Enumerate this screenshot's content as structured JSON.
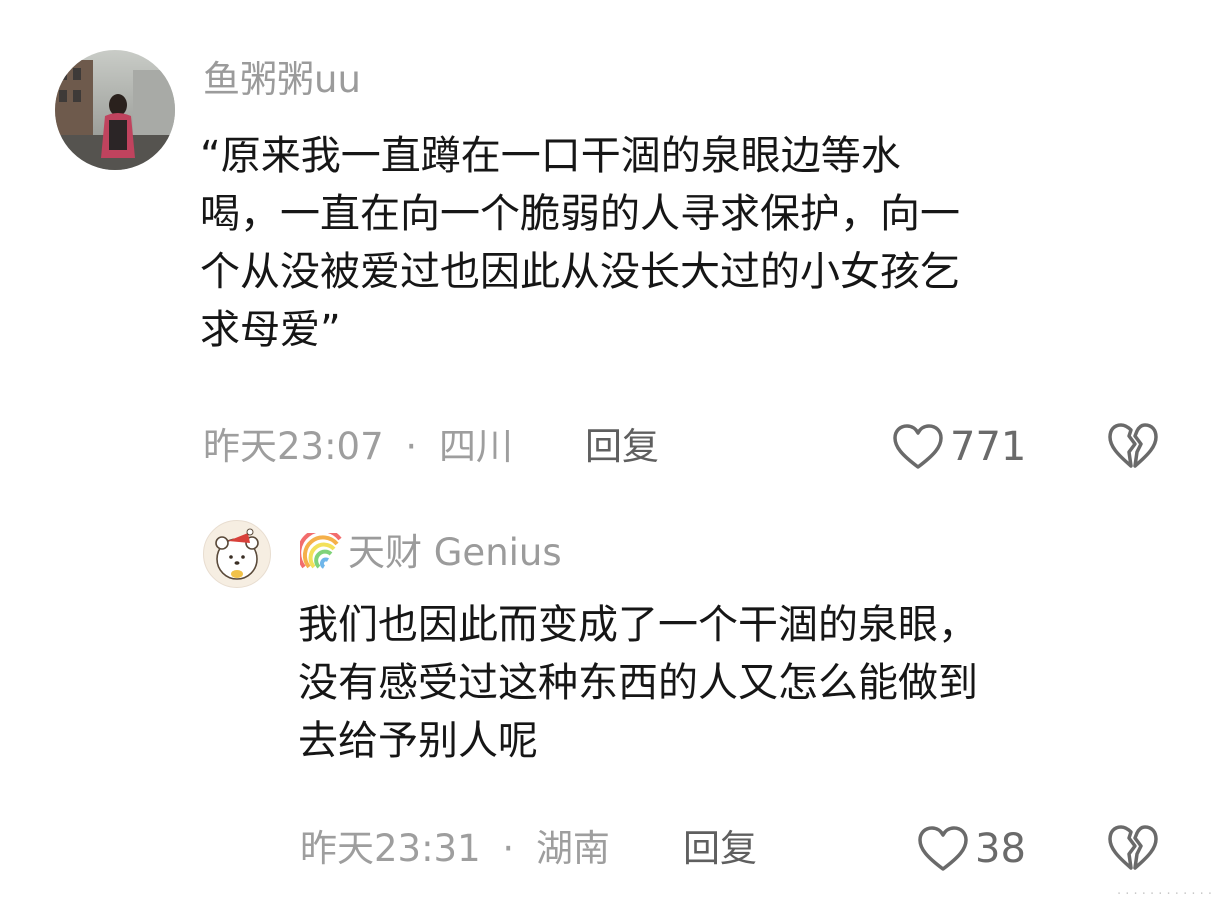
{
  "comments": [
    {
      "avatar_icon": "photo-avatar-icon",
      "username": "鱼粥粥uu",
      "content": "“原来我一直蹲在一口干涸的泉眼边等水\n喝，一直在向一个脆弱的人寻求保护，向一\n个从没被爱过也因此从没长大过的小女孩乞\n求母爱”",
      "time": "昨天23:07",
      "separator": "·",
      "location": "四川",
      "reply_label": "回复",
      "like_icon": "heart-icon",
      "like_count": "771",
      "dislike_icon": "broken-heart-icon"
    }
  ],
  "reply": {
    "avatar_icon": "bear-avatar-icon",
    "badge_icon": "rainbow-icon",
    "username": "天财 Genius",
    "content": "我们也因此而变成了一个干涸的泉眼，\n没有感受过这种东西的人又怎么能做到\n去给予别人呢",
    "time": "昨天23:31",
    "separator": "·",
    "location": "湖南",
    "reply_label": "回复",
    "like_icon": "heart-icon",
    "like_count": "38",
    "dislike_icon": "broken-heart-icon"
  },
  "colors": {
    "username": "#9b9b9b",
    "text": "#161616",
    "meta": "#9e9e9e",
    "icon": "#6a6a6a"
  },
  "watermark": "· · · · · · · · · · · ·"
}
